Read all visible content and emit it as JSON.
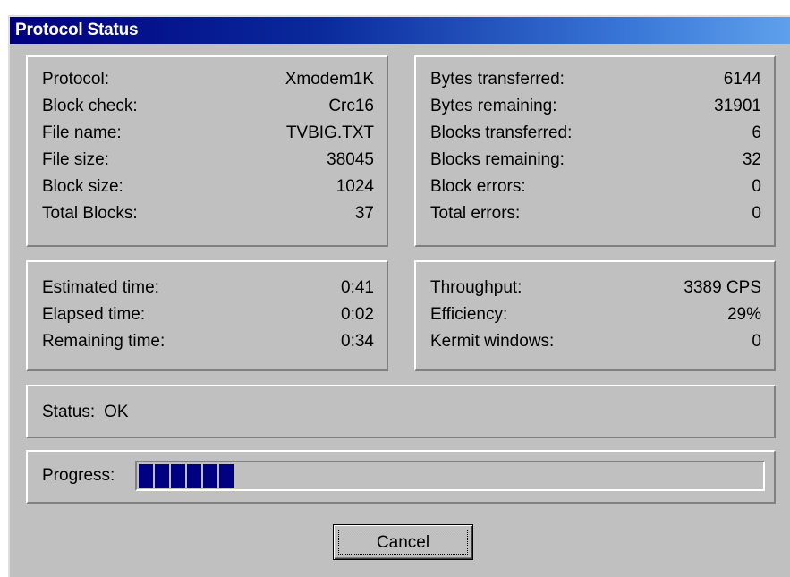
{
  "window": {
    "title": "Protocol Status"
  },
  "protocol_info": [
    {
      "label": "Protocol:",
      "value": "Xmodem1K"
    },
    {
      "label": "Block check:",
      "value": "Crc16"
    },
    {
      "label": "File name:",
      "value": "TVBIG.TXT"
    },
    {
      "label": "File size:",
      "value": "38045"
    },
    {
      "label": "Block size:",
      "value": "1024"
    },
    {
      "label": "Total Blocks:",
      "value": "37"
    }
  ],
  "transfer_info": [
    {
      "label": "Bytes transferred:",
      "value": "6144"
    },
    {
      "label": "Bytes remaining:",
      "value": "31901"
    },
    {
      "label": "Blocks transferred:",
      "value": "6"
    },
    {
      "label": "Blocks remaining:",
      "value": "32"
    },
    {
      "label": "Block errors:",
      "value": "0"
    },
    {
      "label": "Total errors:",
      "value": "0"
    }
  ],
  "time_info": [
    {
      "label": "Estimated time:",
      "value": "0:41"
    },
    {
      "label": "Elapsed time:",
      "value": "0:02"
    },
    {
      "label": "Remaining time:",
      "value": "0:34"
    }
  ],
  "throughput_info": [
    {
      "label": "Throughput:",
      "value": "3389 CPS"
    },
    {
      "label": "Efficiency:",
      "value": "29%"
    },
    {
      "label": "Kermit windows:",
      "value": "0"
    }
  ],
  "status": {
    "label": "Status:",
    "value": "OK"
  },
  "progress": {
    "label": "Progress:",
    "fraction": 0.162,
    "blocks_shown": 6
  },
  "buttons": {
    "cancel_label": "Cancel"
  },
  "colors": {
    "face": "#c0c0c0",
    "title_start": "#00007f",
    "title_end": "#5fa0ec",
    "progress_fill": "#000080"
  }
}
